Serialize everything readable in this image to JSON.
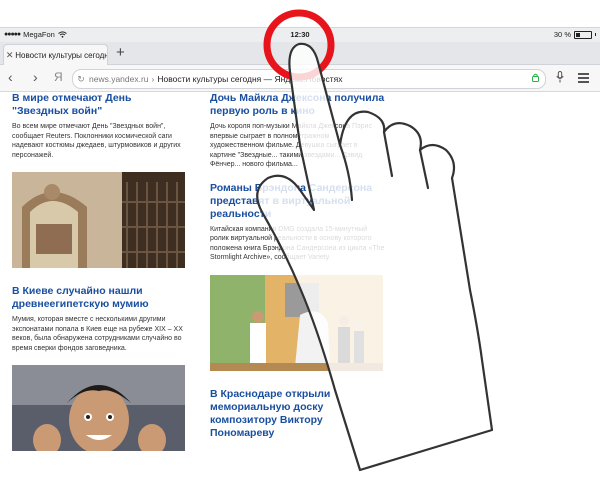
{
  "status_bar": {
    "carrier": "MegaFon",
    "time": "12:30",
    "battery": "30 %",
    "battery_level": 0.3
  },
  "tabs": [
    {
      "label": "Новости культуры сегодня"
    }
  ],
  "toolbar": {
    "logo": "Я",
    "url_domain": "news.yandex.ru",
    "url_separator": "›",
    "url_title": "Новости культуры сегодня — Яндекс.Новостях"
  },
  "articles_left": [
    {
      "title": "В мире отмечают День \"Звездных войн\"",
      "desc": "Во всем мире отмечают День \"Звездных войн\", сообщает Reuters. Поклонники космической саги надевают костюмы джедаев, штурмовиков и других персонажей."
    },
    {
      "title": "В Киеве случайно нашли древнеегипетскую мумию",
      "desc": "Мумия, которая вместе с несколькими другими экспонатами попала в Киев еще на рубеже XIX – XX веков, была обнаружена сотрудниками случайно во время сверки фондов заговедника."
    }
  ],
  "articles_right": [
    {
      "title": "Дочь Майкла Джексона получила первую роль в кино",
      "desc": "Дочь короля поп-музыки Майкла Джексона Пэрис впервые сыграет в полнометражном художественном фильме. Девушка сыграет в картине \"Звездные... такими звездами... Дэвид Фёнчер... нового фильма..."
    },
    {
      "title": "Романы Брэндона Сандерсона представят в виртуальной реальности",
      "desc": "Китайская компания DMG создала 15-минутный ролик виртуальной реальности в основу которого положена книга Брэндона Сандерсона из цикла «The Stormlight Archive», сообщает Variety."
    },
    {
      "title": "В Краснодаре открыли мемориальную доску композитору Виктору Пономареву",
      "desc": ""
    }
  ],
  "colors": {
    "link": "#1a4fa0",
    "touch_ring": "#e8141b",
    "browser_chrome": "#e4e6e9"
  }
}
